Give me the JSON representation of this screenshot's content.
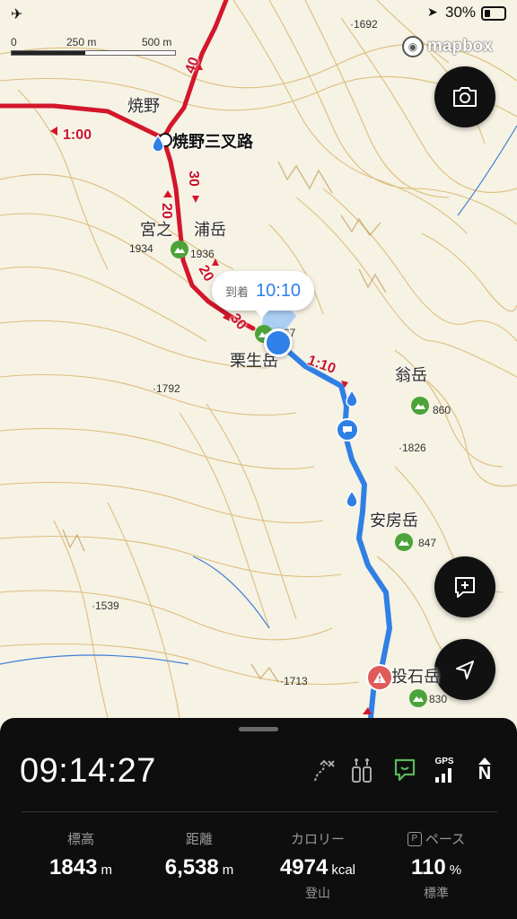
{
  "status_bar": {
    "battery_text": "30%"
  },
  "scale": {
    "label_0": "0",
    "label_250": "250 m",
    "label_500": "500 m"
  },
  "attribution": {
    "brand": "mapbox"
  },
  "place_labels": {
    "yakeno": "焼野",
    "yakeno_junction": "焼野三叉路",
    "miyanoura_a": "宮之",
    "miyanoura_b": "浦岳",
    "kurio": "栗生岳",
    "okina": "翁岳",
    "ambo": "安房岳",
    "nageishi": "投石岳"
  },
  "elevations": {
    "e1692": "·1692",
    "e1934": "1934",
    "e1936": "1936",
    "e1867": "67",
    "e1792": "·1792",
    "e1860": "860",
    "e1826": "·1826",
    "e1847": "847",
    "e1539": "·1539",
    "e1713": "·1713",
    "e1830": "830"
  },
  "segment_times": {
    "t1": "1:00",
    "t2": "40",
    "t3": "30",
    "t4": "20",
    "t5": "20",
    "t6": "30",
    "t7": "1:10"
  },
  "arrival_callout": {
    "label": "到着",
    "time": "10:10"
  },
  "panel": {
    "clock": "09:14:27",
    "gps_label": "GPS",
    "north_label": "N",
    "stats": {
      "altitude": {
        "label": "標高",
        "value": "1843",
        "unit": "m"
      },
      "distance": {
        "label": "距離",
        "value": "6,538",
        "unit": "m"
      },
      "calories": {
        "label": "カロリー",
        "value": "4974",
        "unit": "kcal",
        "sub": "登山"
      },
      "pace": {
        "badge": "P",
        "label": "ペース",
        "value": "110",
        "unit": "%",
        "sub": "標準"
      }
    }
  },
  "colors": {
    "route_red": "#d3162b",
    "route_blue": "#2f7fe4",
    "contour": "#d9b56a",
    "panel_bg": "#0e0e0e",
    "peak_green": "#4ca33a",
    "accent_blue": "#2f80e8"
  }
}
